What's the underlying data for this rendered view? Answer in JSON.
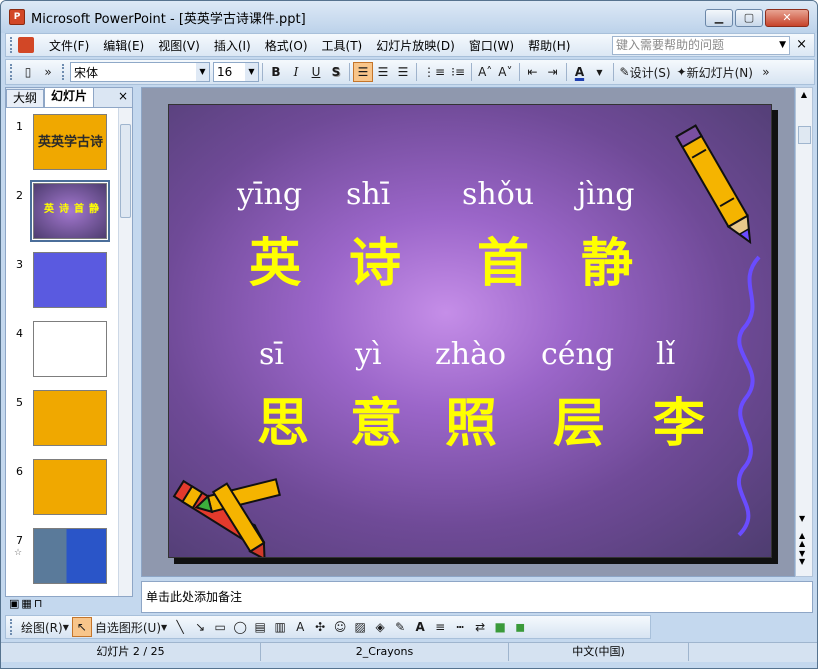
{
  "window": {
    "title": "Microsoft PowerPoint - [英英学古诗课件.ppt]",
    "icon_label": "P",
    "minimize_icon": "minimize-icon",
    "maximize_icon": "maximize-icon",
    "close_icon": "close-icon"
  },
  "menubar": {
    "items": [
      "文件(F)",
      "编辑(E)",
      "视图(V)",
      "插入(I)",
      "格式(O)",
      "工具(T)",
      "幻灯片放映(D)",
      "窗口(W)",
      "帮助(H)"
    ],
    "help_placeholder": "键入需要帮助的问题",
    "close_glyph": "×"
  },
  "toolbar": {
    "font_name": "宋体",
    "font_size": "16",
    "bold": "B",
    "italic": "I",
    "underline": "U",
    "shadow": "S",
    "design_label": "设计(S)",
    "new_slide_label": "新幻灯片(N)",
    "font_color_glyph": "A"
  },
  "panel": {
    "tabs": [
      "大纲",
      "幻灯片"
    ],
    "close_glyph": "×",
    "slides": [
      {
        "num": "1",
        "bg": "#f0a800",
        "text": "英英学古诗"
      },
      {
        "num": "2",
        "bg": "#5a4a82",
        "text": "英诗首静"
      },
      {
        "num": "3",
        "bg": "#5a5ae0",
        "text": ""
      },
      {
        "num": "4",
        "bg": "#ffffff",
        "text": ""
      },
      {
        "num": "5",
        "bg": "#f0a800",
        "text": ""
      },
      {
        "num": "6",
        "bg": "#f0a800",
        "text": ""
      },
      {
        "num": "7",
        "bg": "#2a55c8",
        "text": "",
        "star": "☆"
      }
    ]
  },
  "slide": {
    "pinyin_row1": [
      "yīng",
      "shī",
      "shǒu",
      "jìng"
    ],
    "hanzi_row1": [
      "英",
      "诗",
      "首",
      "静"
    ],
    "pinyin_row2": [
      "sī",
      "yì",
      "zhào",
      "céng",
      "lǐ"
    ],
    "hanzi_row2": [
      "思",
      "意",
      "照",
      "层",
      "李"
    ],
    "accent_text": "#ffff00",
    "accent_line": "#6a4cff"
  },
  "notes": {
    "placeholder": "单击此处添加备注"
  },
  "drawbar": {
    "draw_label": "绘图(R)",
    "autoshape_label": "自选图形(U)"
  },
  "status": {
    "slide_pos": "幻灯片 2 / 25",
    "design": "2_Crayons",
    "language": "中文(中国)"
  }
}
